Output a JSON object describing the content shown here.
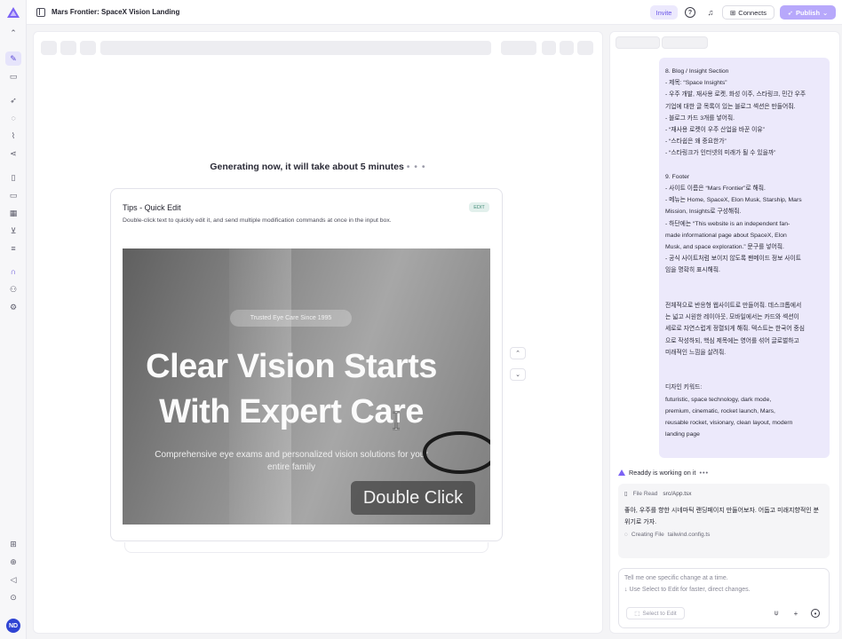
{
  "app": {
    "title": "Mars Frontier: SpaceX Vision Landing",
    "brand_color": "#7c63f5"
  },
  "topbar": {
    "invite_label": "Invite",
    "connects_label": "Connects",
    "publish_label": "Publish"
  },
  "user": {
    "initials": "ND"
  },
  "preview": {
    "generating_text": "Generating now, it will take about 5 minutes",
    "tips": {
      "title": "Tips - Quick Edit",
      "badge": "EDIT",
      "description": "Double-click text to quickly edit it, and send multiple modification commands at once in the input box.",
      "demo": {
        "pill": "Trusted Eye Care Since 1995",
        "headline_line1": "Clear Vision Starts",
        "headline_line2": "With Expert Care",
        "sub_line1": "Comprehensive eye exams and personalized vision solutions for your",
        "sub_line2": "entire family",
        "action": "Double Click"
      }
    }
  },
  "chat": {
    "user_message_lines": [
      "8. Blog / Insight Section",
      "- 제목: “Space Insights”",
      "- 우주 개발, 재사용 로켓, 화성 이주, 스타링크, 민간 우주",
      "기업에 대한 글 목록이 있는 블로그 섹션은 만들어줘.",
      "- 블로그 카드 3개를 넣어줘.",
      "  - “재사용 로켓이 우주 산업을 바꾼 이유”",
      "  - “스타쉽은 왜 중요한가”",
      "  - “스타링크가 인터넷의 미래가 될 수 있을까”",
      "",
      "9. Footer",
      "- 사이트 이름은 “Mars Frontier”로 해줘.",
      "- 메뉴는 Home, SpaceX, Elon Musk, Starship, Mars",
      "Mission, Insights로 구성해줘.",
      "- 하단에는 “This website is an independent fan-",
      "made informational page about SpaceX, Elon",
      "Musk, and space exploration.” 문구를 넣어줘.",
      "- 공식 사이트처럼 보이지 않도록 팬메이드 정보 사이트",
      "임을 명확히 표시해줘.",
      "",
      "",
      "전체적으로 반응형 웹사이트로 만들어줘. 데스크톱에서",
      "는 넓고 시원한 레이아웃, 모바일에서는 카드와 섹션이",
      "세로로 자연스럽게 정렬되게 해줘. 텍스트는 한국어 중심",
      "으로 작성하되, 핵심 제목에는 영어를 섞어 글로벌하고",
      "미래적인 느낌을 살려줘.",
      "",
      "",
      "디자인 키워드:",
      "futuristic, space technology, dark mode,",
      "premium, cinematic, rocket launch, Mars,",
      "reusable rocket, visionary, clean layout, modern",
      "landing page"
    ],
    "status_text": "Readdy is working on it",
    "work": {
      "read_label": "File Read",
      "read_file": "src/App.tsx",
      "reply": "좋아, 우주를 향한 시네마틱 랜딩페이지 만들어보자. 어둡고 미래지향적인 분위기로 가자.",
      "create_label": "Creating File",
      "create_file": "tailwind.config.ts"
    },
    "input": {
      "placeholder_line1": "Tell me one specific change at a time.",
      "placeholder_line2": "↓ Use Select to Edit for faster, direct changes.",
      "select_label": "Select to Edit"
    }
  }
}
